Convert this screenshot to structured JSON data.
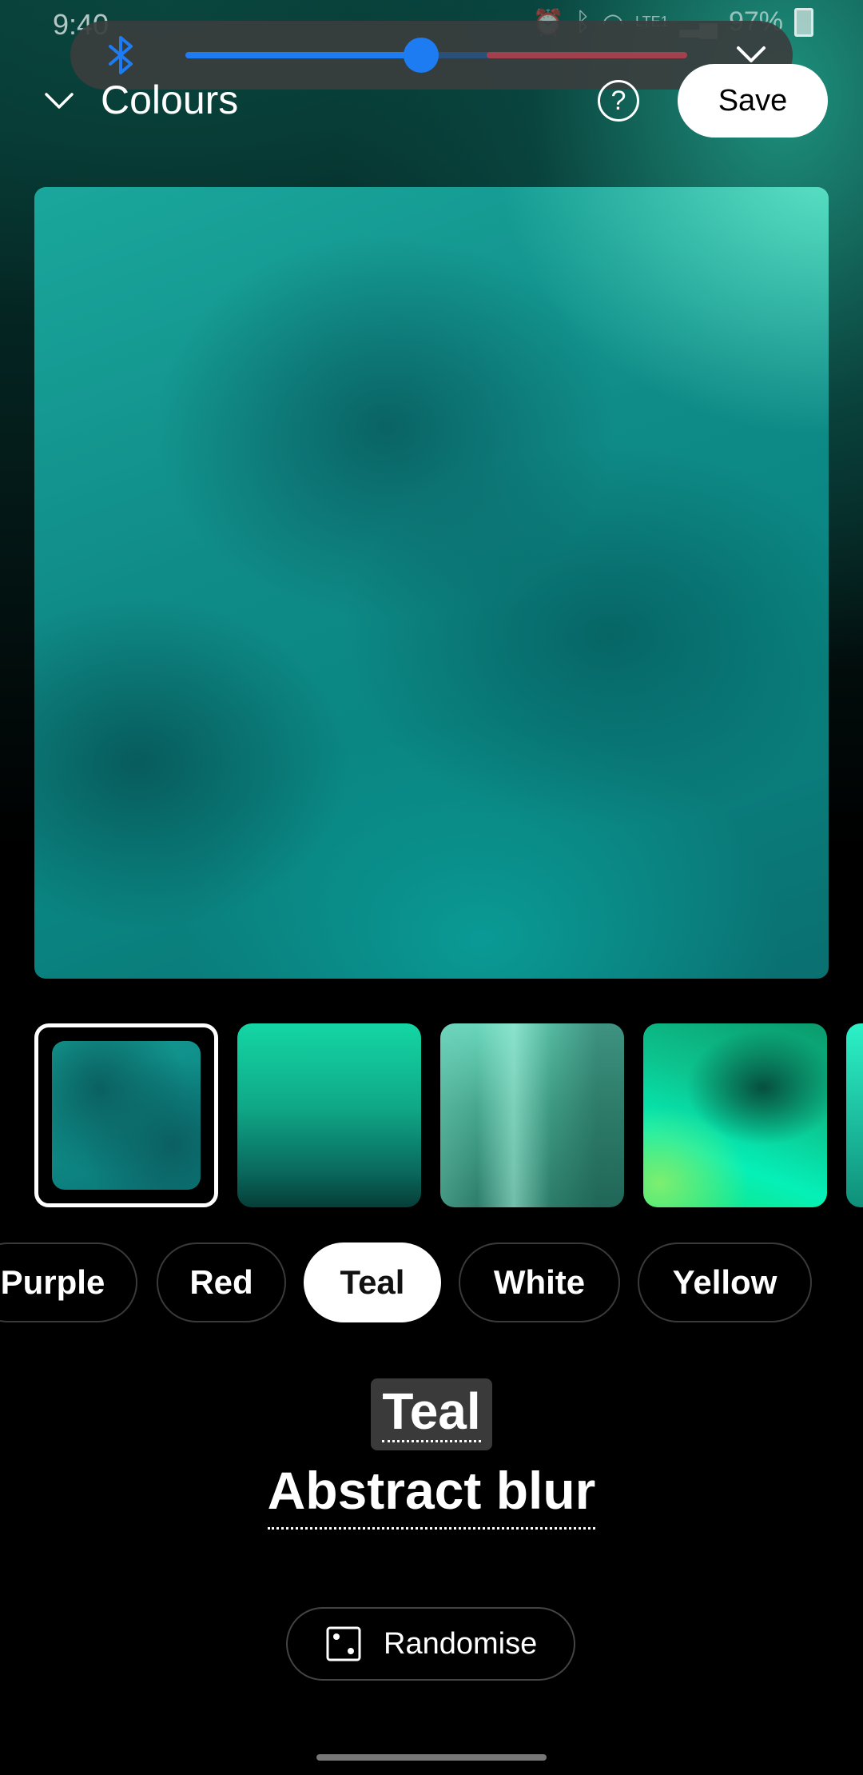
{
  "status_bar": {
    "time": "9:40",
    "network": "LTE1",
    "battery": "97%"
  },
  "volume_panel": {
    "device_icon": "bluetooth-icon",
    "level": 0.47,
    "safe_limit": 0.6,
    "expand_icon": "chevron-down-icon",
    "accent_color": "#1e7cf2",
    "warning_color": "#a3404e"
  },
  "header": {
    "collapse_icon": "chevron-down-icon",
    "title": "Colours",
    "help_icon": "help-icon",
    "help_glyph": "?",
    "save_label": "Save"
  },
  "thumbnails": [
    {
      "name": "teal-abstract-blur",
      "selected": true
    },
    {
      "name": "teal-gradient"
    },
    {
      "name": "teal-streaks"
    },
    {
      "name": "teal-green-blend"
    },
    {
      "name": "teal-partial"
    }
  ],
  "colour_chips": [
    {
      "label": "Purple",
      "selected": false
    },
    {
      "label": "Red",
      "selected": false
    },
    {
      "label": "Teal",
      "selected": true
    },
    {
      "label": "White",
      "selected": false
    },
    {
      "label": "Yellow",
      "selected": false
    }
  ],
  "selection": {
    "colour": "Teal",
    "style": "Abstract blur"
  },
  "randomise": {
    "icon": "dice-icon",
    "label": "Randomise"
  }
}
